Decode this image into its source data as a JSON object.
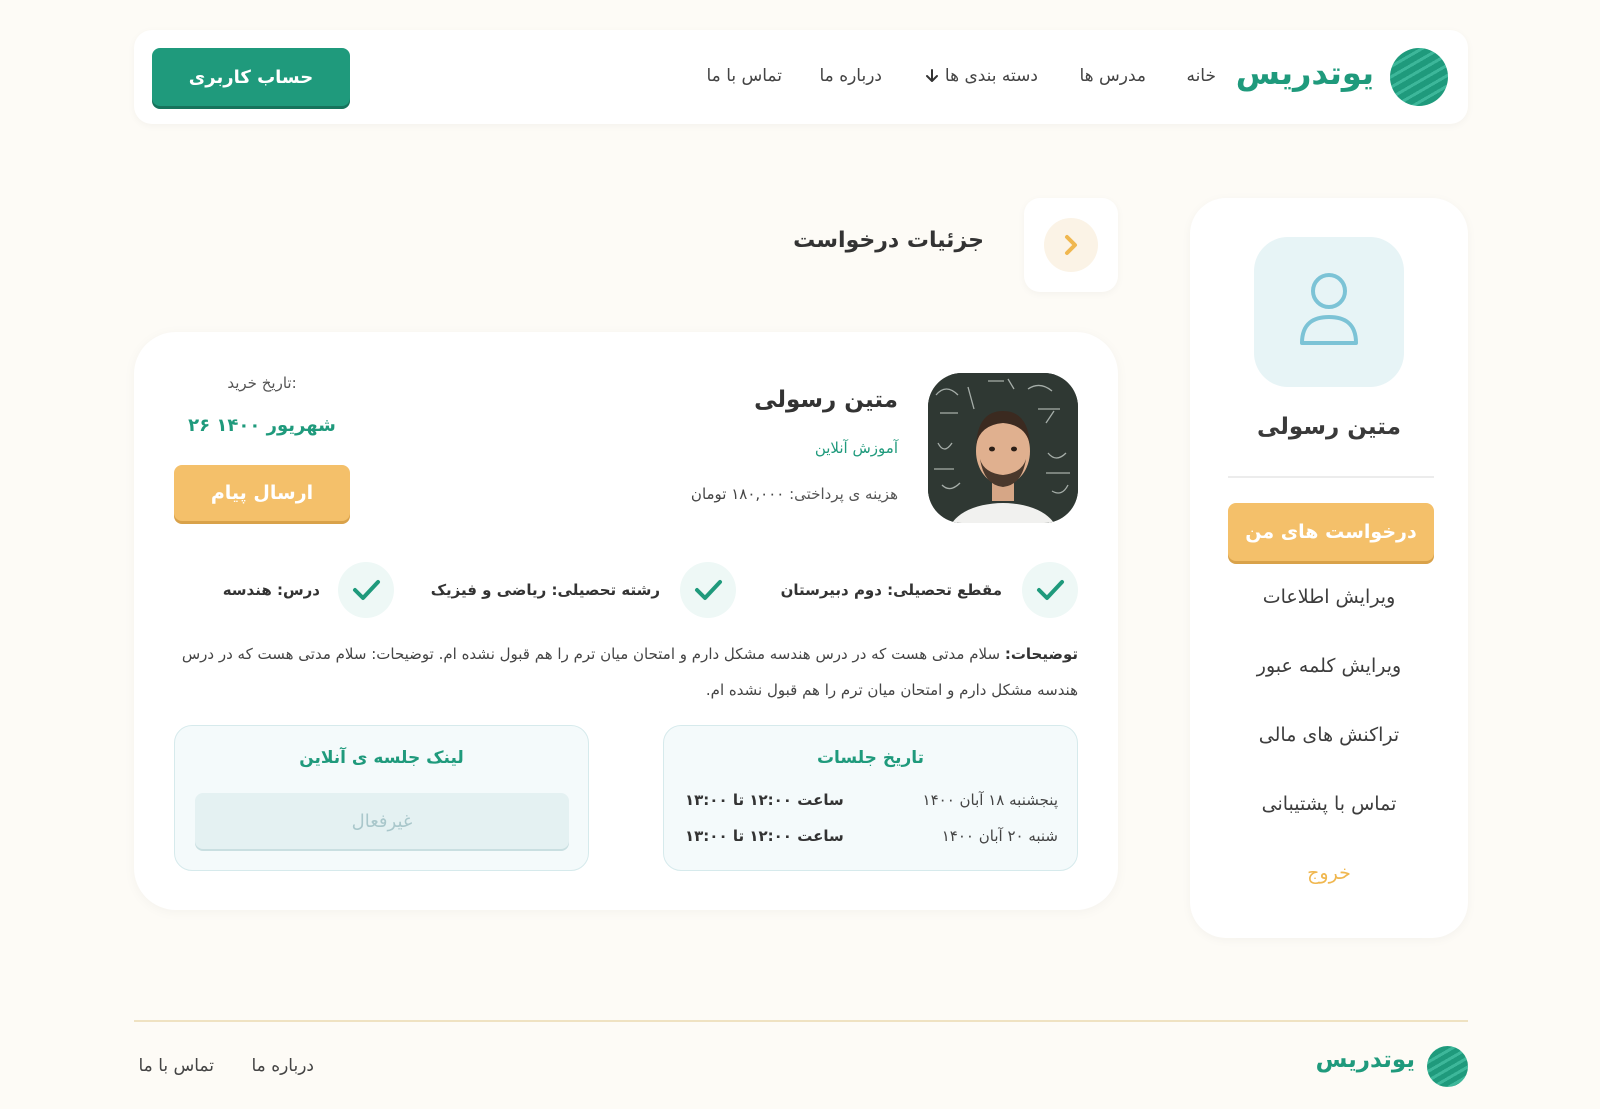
{
  "brand": {
    "name": "یوتدریس",
    "color": "#1f9a7c",
    "accent": "#f4c06a"
  },
  "nav": {
    "home": "خانه",
    "teachers": "مدرس ها",
    "categories": "دسته بندی ها",
    "about": "درباره ما",
    "contact": "تماس با ما",
    "account_button": "حساب کاربری"
  },
  "sidebar": {
    "user_name": "متین رسولی",
    "active_item": "درخواست های من",
    "items": [
      "ویرایش اطلاعات",
      "ویرایش کلمه عبور",
      "تراکنش های مالی",
      "تماس با پشتیبانی"
    ],
    "exit": "خروج"
  },
  "page": {
    "title": "جزئیات درخواست"
  },
  "request": {
    "teacher_name": "متین رسولی",
    "type": "آموزش آنلاین",
    "fee_label": "هزینه ی پرداختی:",
    "fee_value": "۱۸۰,۰۰۰ تومان",
    "purchase_label": "تاریخ خرید:",
    "purchase_date": "۲۶ شهریور ۱۴۰۰",
    "message_button": "ارسال پیام",
    "attributes": [
      "مقطع تحصیلی: دوم دبیرستان",
      "رشته تحصیلی: ریاضی و فیزیک",
      "درس: هندسه"
    ],
    "description_label": "توضیحات:",
    "description_text": "سلام مدتی هست که در درس هندسه مشکل دارم و امتحان میان ترم را هم قبول نشده ام. توضیحات: سلام مدتی هست که در درس هندسه مشکل دارم و امتحان میان ترم را هم قبول نشده ام.",
    "sessions_title": "تاریخ جلسات",
    "sessions": [
      {
        "date": "پنجشنبه ۱۸ آبان ۱۴۰۰",
        "time": "ساعت ۱۲:۰۰ تا ۱۳:۰۰"
      },
      {
        "date": "شنبه ۲۰ آبان ۱۴۰۰",
        "time": "ساعت ۱۲:۰۰ تا ۱۳:۰۰"
      }
    ],
    "online_link_title": "لینک جلسه ی آنلاین",
    "online_link_status": "غیرفعال"
  },
  "footer": {
    "brand": "یوتدریس",
    "about": "درباره ما",
    "contact": "تماس با ما"
  }
}
